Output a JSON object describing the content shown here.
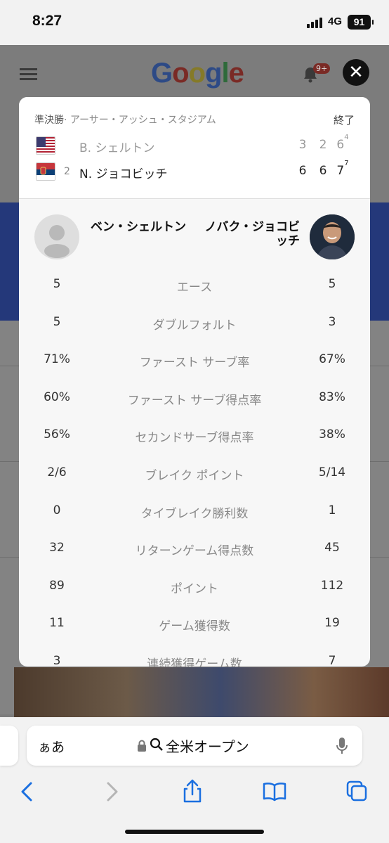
{
  "status_bar": {
    "time": "8:27",
    "network": "4G",
    "battery": "91"
  },
  "background_page": {
    "logo": "Google",
    "notifications_badge": "9+"
  },
  "modal": {
    "close_label": "✕",
    "round": "準決勝",
    "venue": "· アーサー・アッシュ・スタジアム",
    "status": "終了",
    "players": [
      {
        "seed": "",
        "name": "B. シェルトン",
        "flag": "usa",
        "sets": [
          {
            "games": "3",
            "tb": ""
          },
          {
            "games": "2",
            "tb": ""
          },
          {
            "games": "6",
            "tb": "4"
          }
        ],
        "winner": false
      },
      {
        "seed": "2",
        "name": "N. ジョコビッチ",
        "flag": "serbia",
        "sets": [
          {
            "games": "6",
            "tb": ""
          },
          {
            "games": "6",
            "tb": ""
          },
          {
            "games": "7",
            "tb": "7"
          }
        ],
        "winner": true
      }
    ],
    "left_player_full": "ベン・シェルトン",
    "right_player_full": "ノバク・ジョコビッチ",
    "stats": [
      {
        "label": "エース",
        "left": "5",
        "right": "5"
      },
      {
        "label": "ダブルフォルト",
        "left": "5",
        "right": "3"
      },
      {
        "label": "ファースト サーブ率",
        "left": "71%",
        "right": "67%"
      },
      {
        "label": "ファースト サーブ得点率",
        "left": "60%",
        "right": "83%"
      },
      {
        "label": "セカンドサーブ得点率",
        "left": "56%",
        "right": "38%"
      },
      {
        "label": "ブレイク ポイント",
        "left": "2/6",
        "right": "5/14"
      },
      {
        "label": "タイブレイク勝利数",
        "left": "0",
        "right": "1"
      },
      {
        "label": "リターンゲーム得点数",
        "left": "32",
        "right": "45"
      },
      {
        "label": "ポイント",
        "left": "89",
        "right": "112"
      },
      {
        "label": "ゲーム獲得数",
        "left": "11",
        "right": "19"
      },
      {
        "label": "連続獲得ゲーム数",
        "left": "3",
        "right": "7"
      }
    ]
  },
  "safari": {
    "aa_label": "ぁあ",
    "url_text": "全米オープン"
  },
  "icons": [
    "close-icon",
    "lock-icon",
    "search-icon",
    "mic-icon",
    "back-icon",
    "forward-icon",
    "share-icon",
    "bookmarks-icon",
    "tabs-icon",
    "bell-icon",
    "menu-icon"
  ]
}
